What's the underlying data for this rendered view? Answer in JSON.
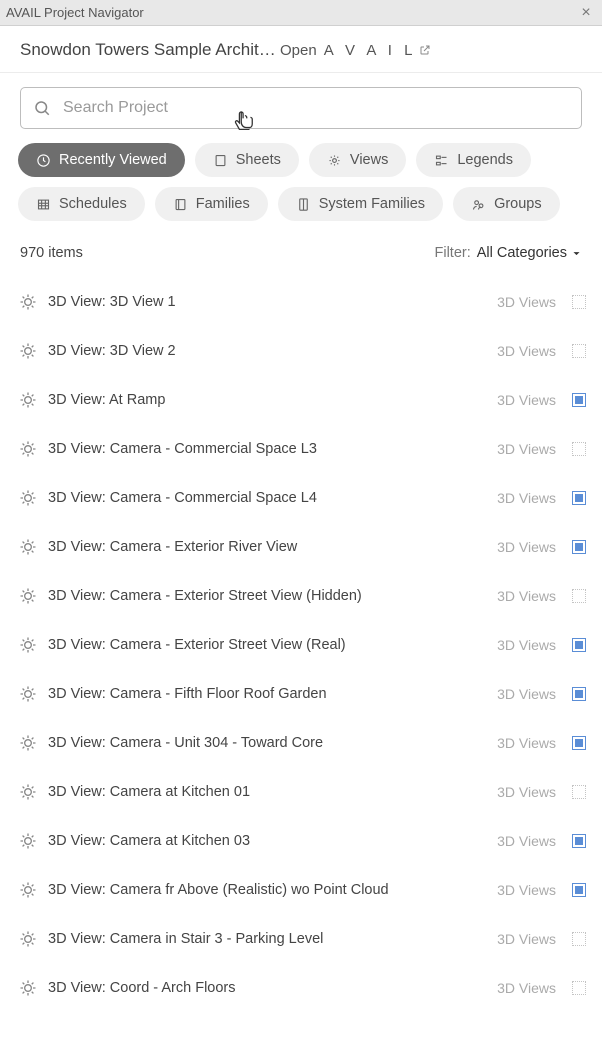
{
  "titlebar": {
    "title": "AVAIL Project Navigator"
  },
  "header": {
    "project_name": "Snowdon Towers Sample Architectu…",
    "open_label": "Open",
    "open_brand": "A V A I L"
  },
  "search": {
    "placeholder": "Search Project"
  },
  "chips": [
    {
      "label": "Recently Viewed",
      "active": true
    },
    {
      "label": "Sheets",
      "active": false
    },
    {
      "label": "Views",
      "active": false
    },
    {
      "label": "Legends",
      "active": false
    },
    {
      "label": "Schedules",
      "active": false
    },
    {
      "label": "Families",
      "active": false
    },
    {
      "label": "System Families",
      "active": false
    },
    {
      "label": "Groups",
      "active": false
    }
  ],
  "meta": {
    "count": "970 items",
    "filter_label": "Filter:",
    "filter_value": "All Categories"
  },
  "rows": [
    {
      "name": "3D View: 3D View 1",
      "category": "3D Views",
      "filled": false
    },
    {
      "name": "3D View: 3D View 2",
      "category": "3D Views",
      "filled": false
    },
    {
      "name": "3D View: At Ramp",
      "category": "3D Views",
      "filled": true
    },
    {
      "name": "3D View: Camera - Commercial Space L3",
      "category": "3D Views",
      "filled": false
    },
    {
      "name": "3D View: Camera - Commercial Space L4",
      "category": "3D Views",
      "filled": true
    },
    {
      "name": "3D View: Camera - Exterior River View",
      "category": "3D Views",
      "filled": true
    },
    {
      "name": "3D View: Camera - Exterior Street View (Hidden)",
      "category": "3D Views",
      "filled": false
    },
    {
      "name": "3D View: Camera - Exterior Street View (Real)",
      "category": "3D Views",
      "filled": true
    },
    {
      "name": "3D View: Camera - Fifth Floor Roof Garden",
      "category": "3D Views",
      "filled": true
    },
    {
      "name": "3D View: Camera - Unit 304 - Toward Core",
      "category": "3D Views",
      "filled": true
    },
    {
      "name": "3D View: Camera at Kitchen 01",
      "category": "3D Views",
      "filled": false
    },
    {
      "name": "3D View: Camera at Kitchen 03",
      "category": "3D Views",
      "filled": true
    },
    {
      "name": "3D View: Camera fr Above (Realistic) wo Point Cloud",
      "category": "3D Views",
      "filled": true
    },
    {
      "name": "3D View: Camera in Stair 3 - Parking Level",
      "category": "3D Views",
      "filled": false
    },
    {
      "name": "3D View: Coord - Arch Floors",
      "category": "3D Views",
      "filled": false
    }
  ]
}
